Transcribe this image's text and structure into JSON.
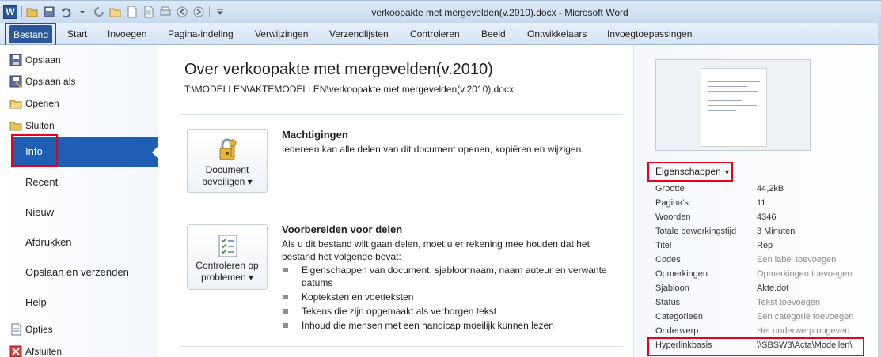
{
  "window": {
    "title": "verkoopakte met mergevelden(v.2010).docx - Microsoft Word",
    "logo_letter": "W"
  },
  "ribbon": {
    "file_tab": "Bestand",
    "tabs": [
      "Start",
      "Invoegen",
      "Pagina-indeling",
      "Verwijzingen",
      "Verzendlijsten",
      "Controleren",
      "Beeld",
      "Ontwikkelaars",
      "Invoegtoepassingen"
    ]
  },
  "backstage_nav": {
    "commands_top": [
      {
        "label": "Opslaan",
        "icon": "save-icon"
      },
      {
        "label": "Opslaan als",
        "icon": "save-as-icon"
      },
      {
        "label": "Openen",
        "icon": "open-folder-icon"
      },
      {
        "label": "Sluiten",
        "icon": "close-folder-icon"
      }
    ],
    "selected": "Info",
    "tabs": [
      "Recent",
      "Nieuw",
      "Afdrukken",
      "Opslaan en verzenden",
      "Help"
    ],
    "commands_bottom": [
      {
        "label": "Opties",
        "icon": "options-icon"
      },
      {
        "label": "Afsluiten",
        "icon": "exit-icon"
      }
    ]
  },
  "info": {
    "title": "Over verkoopakte met mergevelden(v.2010)",
    "path": "T:\\MODELLEN\\AKTEMODELLEN\\verkoopakte met mergevelden(v.2010).docx",
    "permissions": {
      "button_line1": "Document",
      "button_line2": "beveiligen",
      "title": "Machtigingen",
      "text": "Iedereen kan alle delen van dit document openen, kopiëren en wijzigen."
    },
    "prepare": {
      "button_line1": "Controleren op",
      "button_line2": "problemen",
      "title": "Voorbereiden voor delen",
      "text": "Als u dit bestand wilt gaan delen, moet u er rekening mee houden dat het bestand het volgende bevat:",
      "bullets": [
        "Eigenschappen van document, sjabloonnaam, naam auteur en verwante datums",
        "Kopteksten en voetteksten",
        "Tekens die zijn opgemaakt als verborgen tekst",
        "Inhoud die mensen met een handicap moeilijk kunnen lezen"
      ]
    }
  },
  "properties": {
    "header": "Eigenschappen",
    "rows": [
      {
        "key": "Grootte",
        "value": "44,2kB",
        "placeholder": false
      },
      {
        "key": "Pagina's",
        "value": "11",
        "placeholder": false
      },
      {
        "key": "Woorden",
        "value": "4346",
        "placeholder": false
      },
      {
        "key": "Totale bewerkingstijd",
        "value": "3 Minuten",
        "placeholder": false
      },
      {
        "key": "Titel",
        "value": "Rep",
        "placeholder": false
      },
      {
        "key": "Codes",
        "value": "Een label toevoegen",
        "placeholder": true
      },
      {
        "key": "Opmerkingen",
        "value": "Opmerkingen toevoegen",
        "placeholder": true
      },
      {
        "key": "Sjabloon",
        "value": "Akte.dot",
        "placeholder": false
      },
      {
        "key": "Status",
        "value": "Tekst toevoegen",
        "placeholder": true
      },
      {
        "key": "Categorieën",
        "value": "Een categorie toevoegen",
        "placeholder": true
      },
      {
        "key": "Onderwerp",
        "value": "Het onderwerp opgeven",
        "placeholder": true
      },
      {
        "key": "Hyperlinkbasis",
        "value": "\\\\SBSW3\\Acta\\Modellen\\",
        "placeholder": false
      }
    ]
  },
  "colors": {
    "file_tab": "#2b579a",
    "selected_nav": "#1e5fb4",
    "highlight": "#e8001c"
  }
}
